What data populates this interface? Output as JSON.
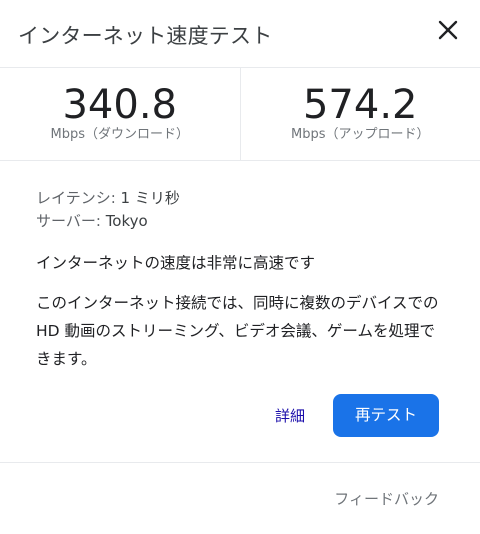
{
  "header": {
    "title": "インターネット速度テスト",
    "close_icon": "close-icon"
  },
  "results": {
    "download": {
      "value": "340.8",
      "unit": "Mbps（ダウンロード）"
    },
    "upload": {
      "value": "574.2",
      "unit": "Mbps（アップロード）"
    }
  },
  "details": {
    "latency_label": "レイテンシ:",
    "latency_value": "1 ミリ秒",
    "server_label": "サーバー:",
    "server_value": "Tokyo",
    "headline": "インターネットの速度は非常に高速です",
    "description": "このインターネット接続では、同時に複数のデバイスでの HD 動画のストリーミング、ビデオ会議、ゲームを処理できます。"
  },
  "actions": {
    "details_link": "詳細",
    "retest_button": "再テスト"
  },
  "footer": {
    "feedback": "フィードバック"
  },
  "colors": {
    "accent": "#1a73e8",
    "link": "#1a0dab",
    "muted": "#70757a",
    "divider": "#e8eaed"
  }
}
